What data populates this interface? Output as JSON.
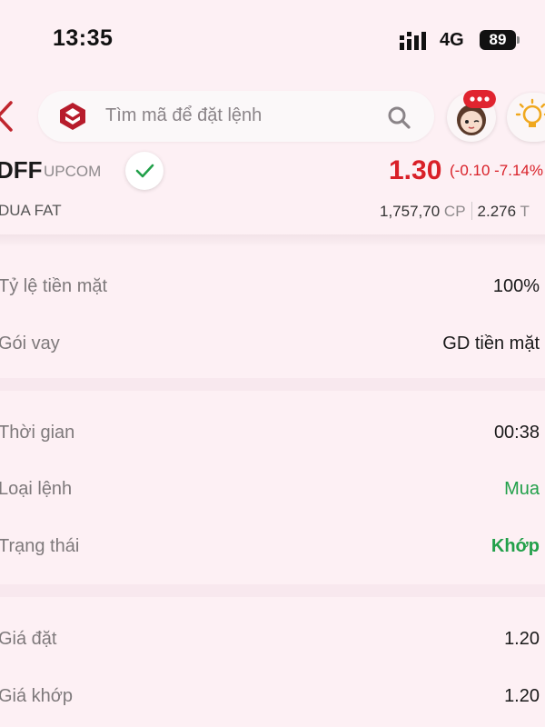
{
  "status_bar": {
    "time": "13:35",
    "network": "4G",
    "battery": "89"
  },
  "header": {
    "search_placeholder": "Tìm mã để đặt lệnh",
    "icons": [
      "chevron-left-icon",
      "brand-logo-icon",
      "search-icon",
      "avatar",
      "chat-badge-icon",
      "lightbulb-icon"
    ]
  },
  "stock": {
    "ticker": "DFF",
    "exchange": "UPCOM",
    "price": "1.30",
    "change": "(-0.10 -7.14%",
    "company": "DUA FAT",
    "volume": "1,757,70",
    "volume_unit": "CP",
    "value": "2.276",
    "value_unit": "T"
  },
  "sections": [
    {
      "rows": [
        {
          "label": "Tỷ lệ tiền mặt",
          "value": "100%"
        },
        {
          "label": "Gói vay",
          "value": "GD tiền mặt"
        }
      ]
    },
    {
      "rows": [
        {
          "label": "Thời gian",
          "value": "00:38"
        },
        {
          "label": "Loại lệnh",
          "value": "Mua"
        },
        {
          "label": "Trạng thái",
          "value": "Khớp"
        }
      ]
    },
    {
      "rows": [
        {
          "label": "Giá đặt",
          "value": "1.20"
        },
        {
          "label": "Giá khớp",
          "value": "1.20"
        }
      ]
    }
  ],
  "colors": {
    "background": "#fdf0f4",
    "accent_red": "#d92028",
    "positive_green": "#22a04a"
  }
}
